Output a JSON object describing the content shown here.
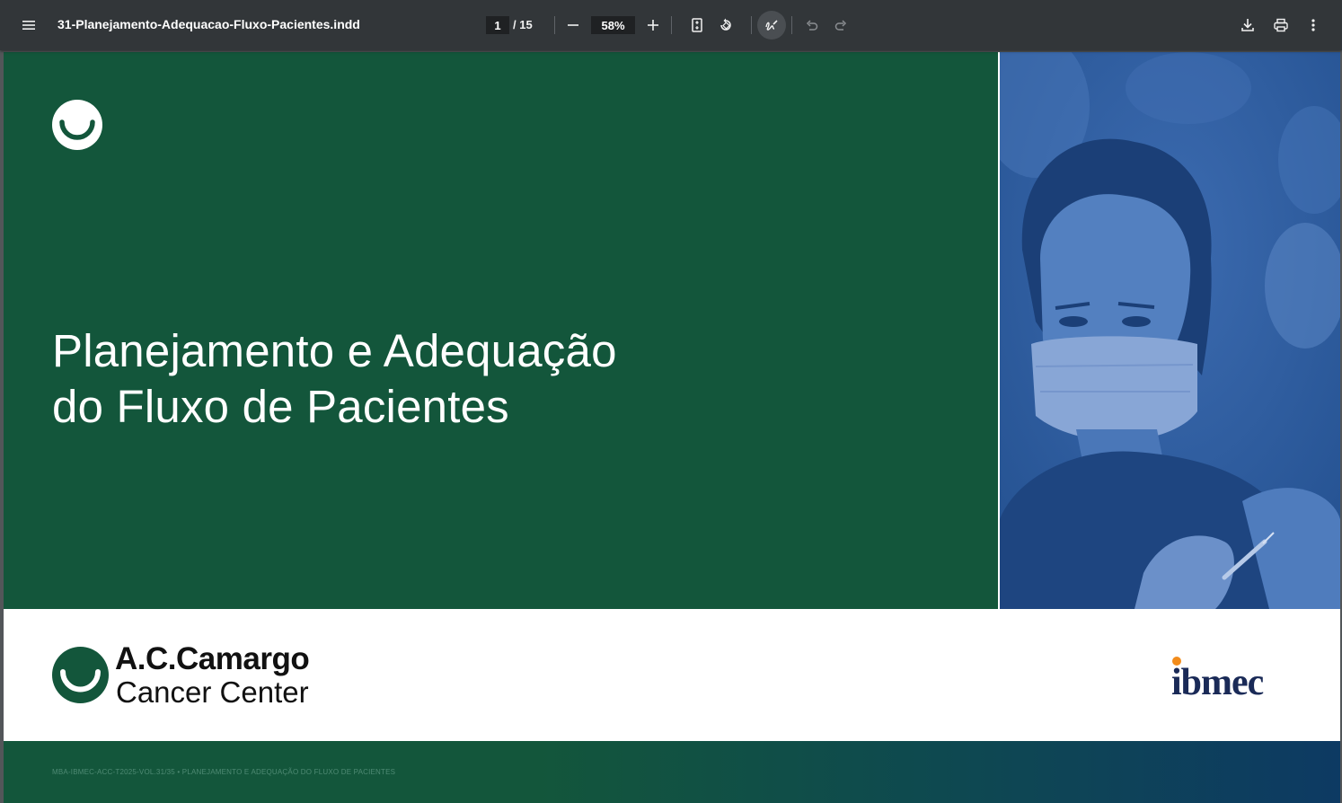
{
  "toolbar": {
    "title": "31-Planejamento-Adequacao-Fluxo-Pacientes.indd",
    "page_current": "1",
    "page_total": "/ 15",
    "zoom": "58%"
  },
  "document": {
    "title_line1": "Planejamento e Adequação",
    "title_line2": "do Fluxo de Pacientes",
    "brand_name": "A.C.Camargo",
    "brand_sub": "Cancer Center",
    "partner_logo": "ibmec",
    "footer": "MBA-IBMEC-ACC-T2025-VOL.31/35 • PLANEJAMENTO E ADEQUAÇÃO DO FLUXO DE PACIENTES"
  },
  "colors": {
    "toolbar_bg": "#323639",
    "brand_green": "#13563b",
    "photo_blue": "#2f5d9f",
    "ibmec_navy": "#1a2a57",
    "ibmec_dot": "#f28c1b"
  },
  "icons": [
    "menu-icon",
    "zoom-out-icon",
    "zoom-in-icon",
    "fit-page-icon",
    "rotate-icon",
    "annotate-icon",
    "undo-icon",
    "redo-icon",
    "download-icon",
    "print-icon",
    "more-options-icon"
  ]
}
